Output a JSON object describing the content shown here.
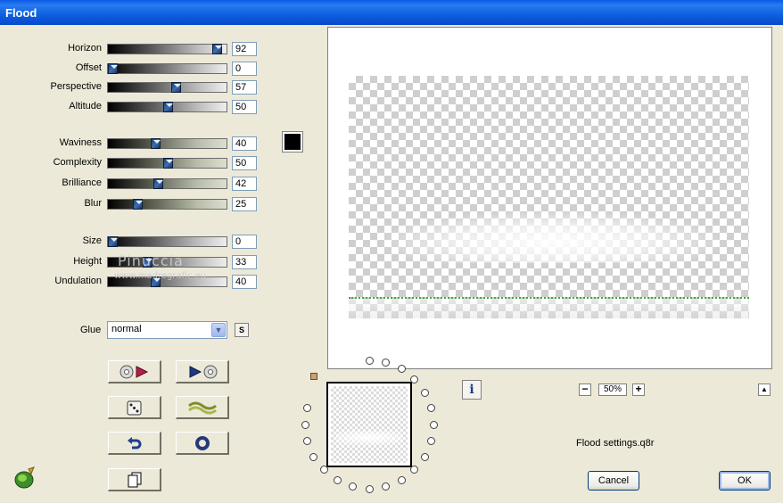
{
  "window": {
    "title": "Flood"
  },
  "sliders": [
    {
      "key": "horizon",
      "label": "Horizon",
      "value": "92",
      "level": 0.92,
      "style": "gray"
    },
    {
      "key": "offset",
      "label": "Offset",
      "value": "0",
      "level": 0.0,
      "style": "gray"
    },
    {
      "key": "perspective",
      "label": "Perspective",
      "value": "57",
      "level": 0.57,
      "style": "gray"
    },
    {
      "key": "altitude",
      "label": "Altitude",
      "value": "50",
      "level": 0.5,
      "style": "gray"
    },
    {
      "key": "waviness",
      "label": "Waviness",
      "value": "40",
      "level": 0.4,
      "style": "green"
    },
    {
      "key": "complexity",
      "label": "Complexity",
      "value": "50",
      "level": 0.5,
      "style": "green"
    },
    {
      "key": "brilliance",
      "label": "Brilliance",
      "value": "42",
      "level": 0.42,
      "style": "green"
    },
    {
      "key": "blur",
      "label": "Blur",
      "value": "25",
      "level": 0.25,
      "style": "green"
    },
    {
      "key": "size",
      "label": "Size",
      "value": "0",
      "level": 0.0,
      "style": "gray"
    },
    {
      "key": "height",
      "label": "Height",
      "value": "33",
      "level": 0.33,
      "style": "gray"
    },
    {
      "key": "undulation",
      "label": "Undulation",
      "value": "40",
      "level": 0.4,
      "style": "gray"
    }
  ],
  "color_swatch": {
    "color": "#000000"
  },
  "watermark": {
    "line1": "Pinuccia",
    "line2": "www.madregrafic.eu"
  },
  "glue": {
    "label": "Glue",
    "value": "normal",
    "s_button": "S"
  },
  "zoom": {
    "value": "50%",
    "minus": "−",
    "plus": "+",
    "up": "▲"
  },
  "info_button": "i",
  "settings_file": "Flood settings.q8r",
  "buttons": {
    "cancel": "Cancel",
    "ok": "OK"
  },
  "colors": {
    "titlebar": "#0a5ae8",
    "dialog_bg": "#ece9d8",
    "waterline": "#3fa83f"
  }
}
